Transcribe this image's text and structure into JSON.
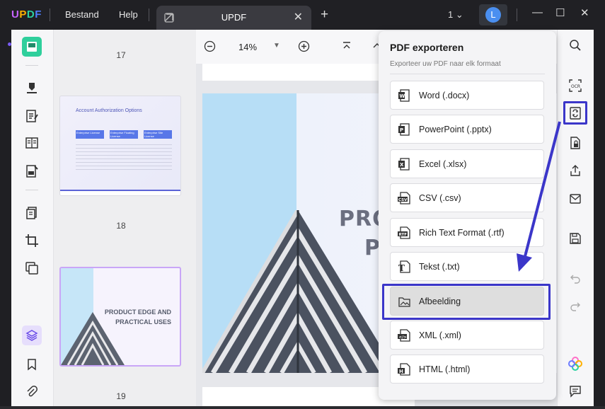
{
  "app": {
    "menu": [
      "Bestand",
      "Help"
    ],
    "tab_title": "UPDF",
    "page_count": "1",
    "avatar_letter": "L"
  },
  "toolbar": {
    "zoom": "14%"
  },
  "thumbnails": {
    "labels": [
      "17",
      "18",
      "19"
    ],
    "thumb1": {
      "title": "Account Authorization Options",
      "columns": [
        "Enterprise License",
        "Enterprise Floating License",
        "Enterprise Site License"
      ]
    },
    "thumb2": {
      "title_line1": "PRODUCT EDGE AND",
      "title_line2": "PRACTICAL USES"
    }
  },
  "document": {
    "title_line1": "PRODU",
    "title_line2": "PR"
  },
  "export": {
    "title": "PDF exporteren",
    "subtitle": "Exporteer uw PDF naar elk formaat",
    "items": [
      {
        "label": "Word (.docx)",
        "icon": "word-icon"
      },
      {
        "label": "PowerPoint (.pptx)",
        "icon": "powerpoint-icon"
      },
      {
        "label": "Excel (.xlsx)",
        "icon": "excel-icon"
      },
      {
        "label": "CSV (.csv)",
        "icon": "csv-icon"
      },
      {
        "label": "Rich Text Format (.rtf)",
        "icon": "rtf-icon"
      },
      {
        "label": "Tekst (.txt)",
        "icon": "text-icon"
      },
      {
        "label": "Afbeelding",
        "icon": "image-icon"
      },
      {
        "label": "XML (.xml)",
        "icon": "xml-icon"
      },
      {
        "label": "HTML (.html)",
        "icon": "html-icon"
      }
    ],
    "selected_label": "Afbeelding"
  },
  "colors": {
    "highlight": "#3b36c9",
    "accent": "#7a5cf5"
  }
}
